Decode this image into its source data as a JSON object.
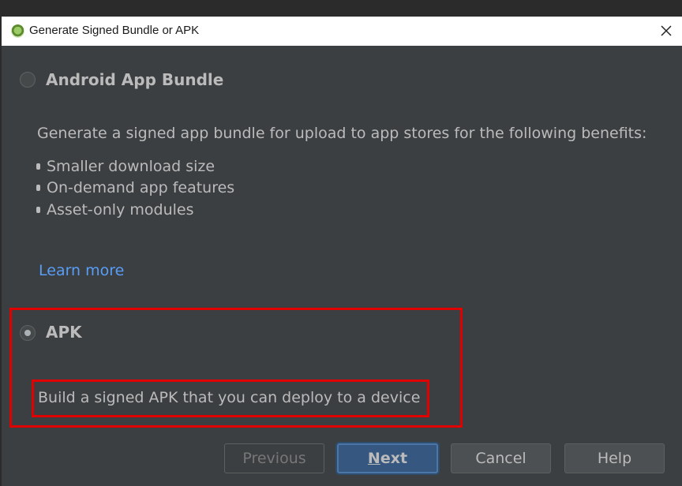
{
  "window": {
    "title": "Generate Signed Bundle or APK",
    "app_icon": "android-studio-icon",
    "close_icon": "close-icon"
  },
  "options": {
    "bundle": {
      "label": "Android App Bundle",
      "selected": false,
      "description": "Generate a signed app bundle for upload to app stores for the following benefits:",
      "benefits": [
        "Smaller download size",
        "On-demand app features",
        "Asset-only modules"
      ],
      "learn_more": "Learn more"
    },
    "apk": {
      "label": "APK",
      "selected": true,
      "description": "Build a signed APK that you can deploy to a device"
    }
  },
  "buttons": {
    "previous": "Previous",
    "next_first": "N",
    "next_rest": "ext",
    "cancel": "Cancel",
    "help": "Help"
  },
  "colors": {
    "dialog_bg": "#3c3f41",
    "link": "#589df6",
    "highlight": "#e00000",
    "primary_button": "#365880"
  }
}
